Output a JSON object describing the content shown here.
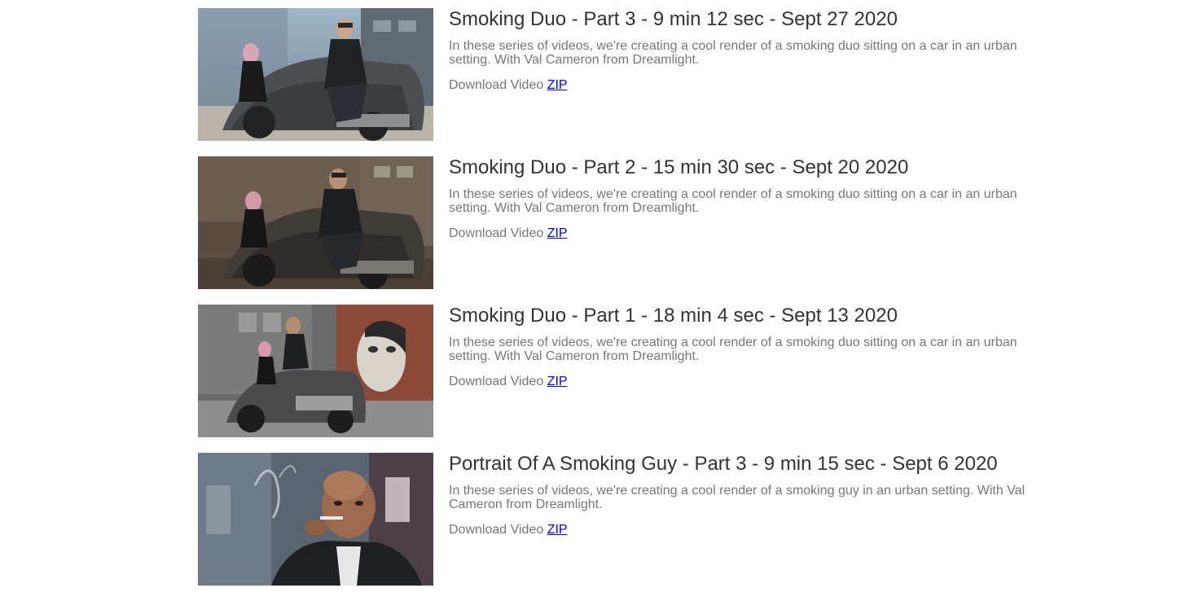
{
  "videos": [
    {
      "title": "Smoking Duo - Part 3 - 9 min 12 sec - Sept 27 2020",
      "description": "In these series of videos, we're creating a cool render of a smoking duo sitting on a car in an urban setting. With Val Cameron from Dreamlight.",
      "download_label": "Download Video",
      "link_label": "ZIP"
    },
    {
      "title": "Smoking Duo - Part 2 - 15 min 30 sec - Sept 20 2020",
      "description": "In these series of videos, we're creating a cool render of a smoking duo sitting on a car in an urban setting. With Val Cameron from Dreamlight.",
      "download_label": "Download Video",
      "link_label": "ZIP"
    },
    {
      "title": "Smoking Duo - Part 1 - 18 min 4 sec - Sept 13 2020",
      "description": "In these series of videos, we're creating a cool render of a smoking duo sitting on a car in an urban setting. With Val Cameron from Dreamlight.",
      "download_label": "Download Video",
      "link_label": "ZIP"
    },
    {
      "title": "Portrait Of A Smoking Guy - Part 3 - 9 min 15 sec - Sept 6 2020",
      "description": "In these series of videos, we're creating a cool render of a smoking guy in an urban setting. With Val Cameron from Dreamlight.",
      "download_label": "Download Video",
      "link_label": "ZIP"
    }
  ],
  "colors": {
    "title_text": "#333333",
    "body_text": "#777777",
    "link": "#0000ee"
  }
}
